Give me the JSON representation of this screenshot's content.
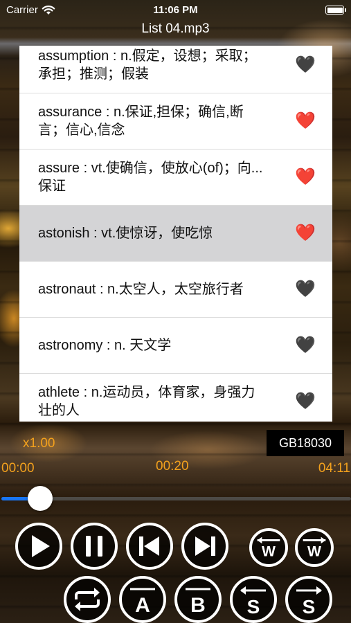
{
  "status_bar": {
    "carrier": "Carrier",
    "time": "11:06 PM"
  },
  "nav": {
    "title": "List 04.mp3"
  },
  "words": [
    {
      "text": "assumption : n.假定，设想；采取；承担；推测；假装",
      "favorite": false,
      "selected": false
    },
    {
      "text": "assurance : n.保证,担保；确信,断言；信心,信念",
      "favorite": true,
      "selected": false
    },
    {
      "text": "assure : vt.使确信，使放心(of)；向...保证",
      "favorite": true,
      "selected": false
    },
    {
      "text": "astonish : vt.使惊讶，使吃惊",
      "favorite": true,
      "selected": true
    },
    {
      "text": "astronaut : n.太空人，太空旅行者",
      "favorite": false,
      "selected": false
    },
    {
      "text": "astronomy : n.  天文学",
      "favorite": false,
      "selected": false
    },
    {
      "text": "athlete : n.运动员，体育家，身强力壮的人",
      "favorite": false,
      "selected": false
    }
  ],
  "hearts": {
    "favorite": "❤️",
    "normal": "🖤"
  },
  "player": {
    "speed": "x1.00",
    "encoding": "GB18030",
    "time_start": "00:00",
    "time_current": "00:20",
    "time_end": "04:11",
    "progress": 0.08
  },
  "controls": {
    "word_prev_letter": "W",
    "word_next_letter": "W",
    "a_letter": "A",
    "b_letter": "B",
    "sentence_prev_letter": "S",
    "sentence_next_letter": "S"
  },
  "colors": {
    "accent": "#f3a11d",
    "progress": "#1976f5"
  }
}
